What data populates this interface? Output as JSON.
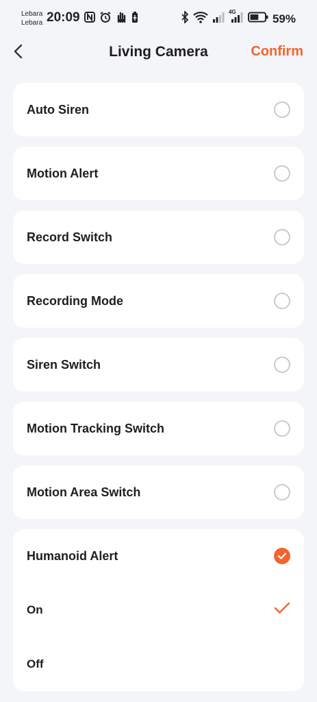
{
  "status_bar": {
    "carrier_1": "Lebara",
    "carrier_2": "Lebara",
    "time": "20:09",
    "network": "4G",
    "battery_percent": "59%",
    "battery_level": 0.59
  },
  "nav": {
    "title": "Living Camera",
    "confirm_label": "Confirm"
  },
  "accent_color": "#f26430",
  "options": [
    {
      "label": "Auto Siren",
      "selected": false
    },
    {
      "label": "Motion Alert",
      "selected": false
    },
    {
      "label": "Record Switch",
      "selected": false
    },
    {
      "label": "Recording Mode",
      "selected": false
    },
    {
      "label": "Siren Switch",
      "selected": false
    },
    {
      "label": "Motion Tracking Switch",
      "selected": false
    },
    {
      "label": "Motion Area Switch",
      "selected": false
    }
  ],
  "expanded_option": {
    "label": "Humanoid Alert",
    "selected": true,
    "values": [
      {
        "label": "On",
        "selected": true
      },
      {
        "label": "Off",
        "selected": false
      }
    ]
  }
}
